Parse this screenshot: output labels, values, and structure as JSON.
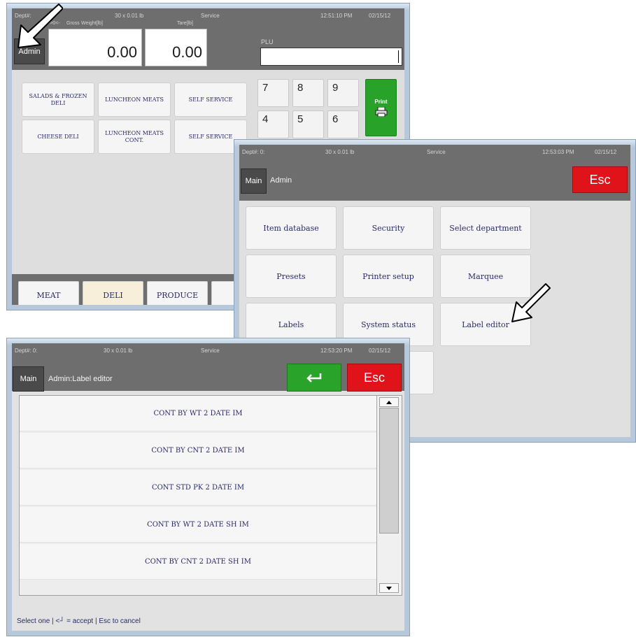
{
  "main_screen": {
    "status": {
      "dept": "Dept#:",
      "unit": "30 x 0.01 lb",
      "mode": "Service",
      "time": "12:51:10 PM",
      "date": "02/15/12"
    },
    "admin_button": "Admin",
    "zero_indicator": "->0<-",
    "gross_label": "Gross",
    "weight_label": "Weight[lb]",
    "weight_value": "0.00",
    "tare_label": "Tare[lb]",
    "tare_value": "0.00",
    "plu_label": "PLU",
    "plu_value": "",
    "departments": [
      {
        "label": "SALADS & FROZEN DELI"
      },
      {
        "label": "LUNCHEON MEATS"
      },
      {
        "label": "SELF SERVICE"
      },
      {
        "label": "CHEESE DELI"
      },
      {
        "label": "LUNCHEON MEATS CONT."
      },
      {
        "label": "SELF SERVICE"
      }
    ],
    "keypad": [
      "7",
      "8",
      "9",
      "4",
      "5",
      "6"
    ],
    "print_label": "Print",
    "tabs": [
      {
        "label": "MEAT",
        "active": false
      },
      {
        "label": "DELI",
        "active": true
      },
      {
        "label": "PRODUCE",
        "active": false
      }
    ]
  },
  "admin_screen": {
    "status": {
      "dept": "Dept#: 0:",
      "unit": "30 x 0.01 lb",
      "mode": "Service",
      "time": "12:53:03 PM",
      "date": "02/15/12"
    },
    "main_button": "Main",
    "title": "Admin",
    "esc_label": "Esc",
    "tiles": [
      {
        "label": "Item database"
      },
      {
        "label": "Security"
      },
      {
        "label": "Select department"
      },
      {
        "label": "Presets"
      },
      {
        "label": "Printer setup"
      },
      {
        "label": "Marquee"
      },
      {
        "label": "Labels"
      },
      {
        "label": "System status"
      },
      {
        "label": "Label editor"
      }
    ]
  },
  "label_editor_screen": {
    "status": {
      "dept": "Dept#: 0:",
      "unit": "30 x 0.01 lb",
      "mode": "Service",
      "time": "12:53:20 PM",
      "date": "02/15/12"
    },
    "main_button": "Main",
    "title": "Admin:Label editor",
    "esc_label": "Esc",
    "enter_icon": "enter-icon",
    "rows": [
      {
        "label": "CONT BY WT 2 DATE IM"
      },
      {
        "label": "CONT BY CNT 2 DATE IM"
      },
      {
        "label": "CONT STD PK 2 DATE IM"
      },
      {
        "label": "CONT BY WT 2 DATE SH IM"
      },
      {
        "label": "CONT BY CNT 2 DATE SH IM"
      }
    ],
    "hint": "Select one | <┘ = accept | Esc to cancel"
  },
  "colors": {
    "esc_red": "#e0121a",
    "accept_green": "#2aa32a",
    "header_gray": "#6e6e6e"
  }
}
